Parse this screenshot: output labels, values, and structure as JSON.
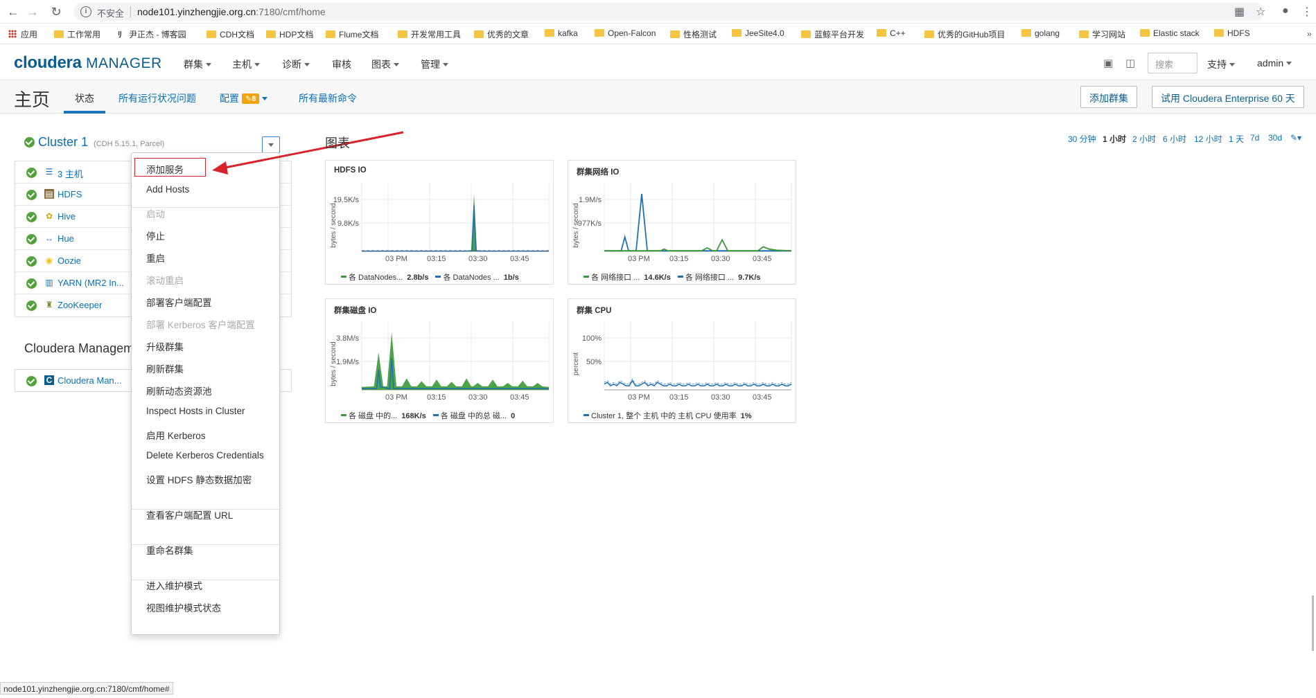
{
  "browser": {
    "insecure": "不安全",
    "url_host": "node101.yinzhengjie.org.cn",
    "url_path": ":7180/cmf/home",
    "status_url": "node101.yinzhengjie.org.cn:7180/cmf/home#"
  },
  "bookmarks": [
    "应用",
    "工作常用",
    "尹正杰 - 博客园",
    "CDH文档",
    "HDP文档",
    "Flume文档",
    "开发常用工具",
    "优秀的文章",
    "kafka",
    "Open-Falcon",
    "性格测试",
    "JeeSite4.0",
    "蓝鲸平台开发",
    "C++",
    "优秀的GitHub项目",
    "golang",
    "学习网站",
    "Elastic stack",
    "HDFS"
  ],
  "logo": {
    "brand": "cloudera",
    "product": "MANAGER"
  },
  "nav": {
    "items": [
      "群集",
      "主机",
      "诊断",
      "审核",
      "图表",
      "管理"
    ],
    "search_placeholder": "搜索",
    "support": "支持",
    "user": "admin"
  },
  "subheader": {
    "title": "主页",
    "tabs": [
      "状态",
      "所有运行状况问题",
      "配置",
      "所有最新命令"
    ],
    "config_badge": "8",
    "add_cluster": "添加群集",
    "trial": "试用 Cloudera Enterprise 60 天"
  },
  "cluster": {
    "name": "Cluster 1",
    "version": "(CDH 5.15.1, Parcel)",
    "services": [
      {
        "name": "3 主机",
        "icon": "hosts-icon"
      },
      {
        "name": "HDFS",
        "icon": "hdfs-icon"
      },
      {
        "name": "Hive",
        "icon": "hive-icon"
      },
      {
        "name": "Hue",
        "icon": "hue-icon"
      },
      {
        "name": "Oozie",
        "icon": "oozie-icon"
      },
      {
        "name": "YARN (MR2 In...",
        "icon": "yarn-icon"
      },
      {
        "name": "ZooKeeper",
        "icon": "zookeeper-icon"
      }
    ]
  },
  "management": {
    "title": "Cloudera Managem",
    "service": "Cloudera Man..."
  },
  "dropdown": {
    "items": [
      {
        "label": "添加服务",
        "disabled": false
      },
      {
        "label": "Add Hosts",
        "disabled": false
      },
      {
        "label": "启动",
        "disabled": true
      },
      {
        "label": "停止",
        "disabled": false
      },
      {
        "label": "重启",
        "disabled": false
      },
      {
        "label": "滚动重启",
        "disabled": true
      },
      {
        "label": "部署客户端配置",
        "disabled": false
      },
      {
        "label": "部署 Kerberos 客户端配置",
        "disabled": true
      },
      {
        "label": "升级群集",
        "disabled": false
      },
      {
        "label": "刷新群集",
        "disabled": false
      },
      {
        "label": "刷新动态资源池",
        "disabled": false
      },
      {
        "label": "Inspect Hosts in Cluster",
        "disabled": false
      },
      {
        "label": "启用 Kerberos",
        "disabled": false
      },
      {
        "label": "Delete Kerberos Credentials",
        "disabled": false
      },
      {
        "label": "设置 HDFS 静态数据加密",
        "disabled": false
      },
      {
        "label": "查看客户端配置 URL",
        "disabled": false
      },
      {
        "label": "重命名群集",
        "disabled": false
      },
      {
        "label": "进入维护模式",
        "disabled": false
      },
      {
        "label": "视图维护模式状态",
        "disabled": false
      }
    ]
  },
  "charts": {
    "title": "图表",
    "time_ranges": [
      "30 分钟",
      "1 小时",
      "2 小时",
      "6 小时",
      "12 小时",
      "1 天",
      "7d",
      "30d"
    ],
    "selected_range": "1 小时",
    "colors": {
      "green": "#3a9a34",
      "blue": "#1f6fb5"
    }
  },
  "chart_data": [
    {
      "type": "area",
      "title": "HDFS IO",
      "ylabel": "bytes / second",
      "yticks": [
        "19.5K/s",
        "9.8K/s"
      ],
      "xticks": [
        "03 PM",
        "03:15",
        "03:30",
        "03:45"
      ],
      "series": [
        {
          "name": "各 DataNodes...",
          "value_label": "2.8b/s",
          "color": "#3a9a34"
        },
        {
          "name": "各 DataNodes ...",
          "value_label": "1b/s",
          "color": "#1f6fb5"
        }
      ]
    },
    {
      "type": "line",
      "title": "群集网络 IO",
      "ylabel": "bytes / second",
      "yticks": [
        "1.9M/s",
        "977K/s"
      ],
      "xticks": [
        "03 PM",
        "03:15",
        "03:30",
        "03:45"
      ],
      "series": [
        {
          "name": "各 网络接口 ...",
          "value_label": "14.6K/s",
          "color": "#3a9a34"
        },
        {
          "name": "各 网络接口 ...",
          "value_label": "9.7K/s",
          "color": "#1f6fb5"
        }
      ]
    },
    {
      "type": "area",
      "title": "群集磁盘 IO",
      "ylabel": "bytes / second",
      "yticks": [
        "3.8M/s",
        "1.9M/s"
      ],
      "xticks": [
        "03 PM",
        "03:15",
        "03:30",
        "03:45"
      ],
      "series": [
        {
          "name": "各 磁盘 中的...",
          "value_label": "168K/s",
          "color": "#3a9a34"
        },
        {
          "name": "各 磁盘 中的总 磁...",
          "value_label": "0",
          "color": "#1f6fb5"
        }
      ]
    },
    {
      "type": "line",
      "title": "群集 CPU",
      "ylabel": "percent",
      "yticks": [
        "100%",
        "50%"
      ],
      "xticks": [
        "03 PM",
        "03:15",
        "03:30",
        "03:45"
      ],
      "series": [
        {
          "name": "Cluster 1, 整个 主机 中的 主机 CPU 使用率",
          "value_label": "1%",
          "color": "#1f6fb5"
        }
      ]
    }
  ]
}
